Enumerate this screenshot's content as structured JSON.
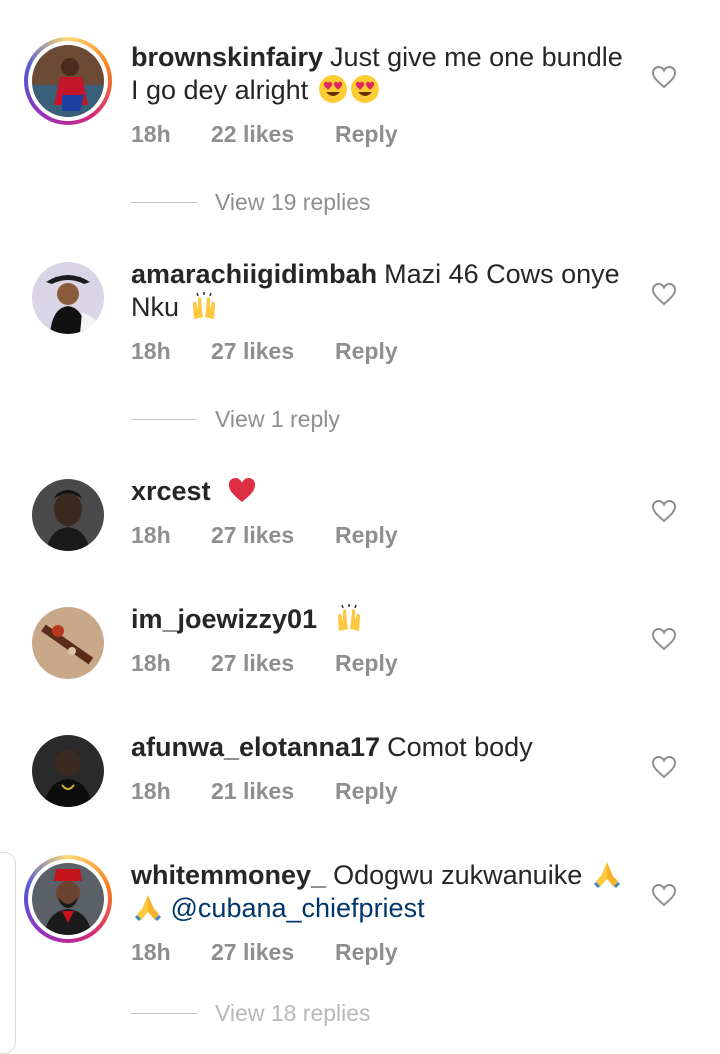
{
  "comments": [
    {
      "username": "brownskinfairy",
      "text": "Just give me one bundle I go dey alright",
      "emojis": [
        "heart-eyes",
        "heart-eyes"
      ],
      "time": "18h",
      "likes": "22 likes",
      "reply": "Reply",
      "view_replies": "View 19 replies",
      "story_ring": true
    },
    {
      "username": "amarachiigidimbah",
      "text": "Mazi 46 Cows onye Nku",
      "emojis": [
        "raising-hands"
      ],
      "time": "18h",
      "likes": "27 likes",
      "reply": "Reply",
      "view_replies": "View 1 reply",
      "story_ring": false
    },
    {
      "username": "xrcest",
      "text": "",
      "emojis": [
        "red-heart"
      ],
      "time": "18h",
      "likes": "27 likes",
      "reply": "Reply",
      "story_ring": false
    },
    {
      "username": "im_joewizzy01",
      "text": "",
      "emojis": [
        "raising-hands"
      ],
      "time": "18h",
      "likes": "27 likes",
      "reply": "Reply",
      "story_ring": false
    },
    {
      "username": "afunwa_elotanna17",
      "text": "Comot body",
      "emojis": [],
      "time": "18h",
      "likes": "21 likes",
      "reply": "Reply",
      "story_ring": false
    },
    {
      "username": "whitemmoney_",
      "text": "Odogwu zukwanuike",
      "emojis": [
        "folded-hands",
        "folded-hands"
      ],
      "mention": "@cubana_chiefpriest",
      "time": "18h",
      "likes": "27 likes",
      "reply": "Reply",
      "view_replies": "View 18 replies",
      "story_ring": true
    }
  ],
  "colors": {
    "username": "#262626",
    "meta": "#8e8e8e",
    "mention": "#00376b",
    "heart_outline": "#8e8e8e"
  }
}
